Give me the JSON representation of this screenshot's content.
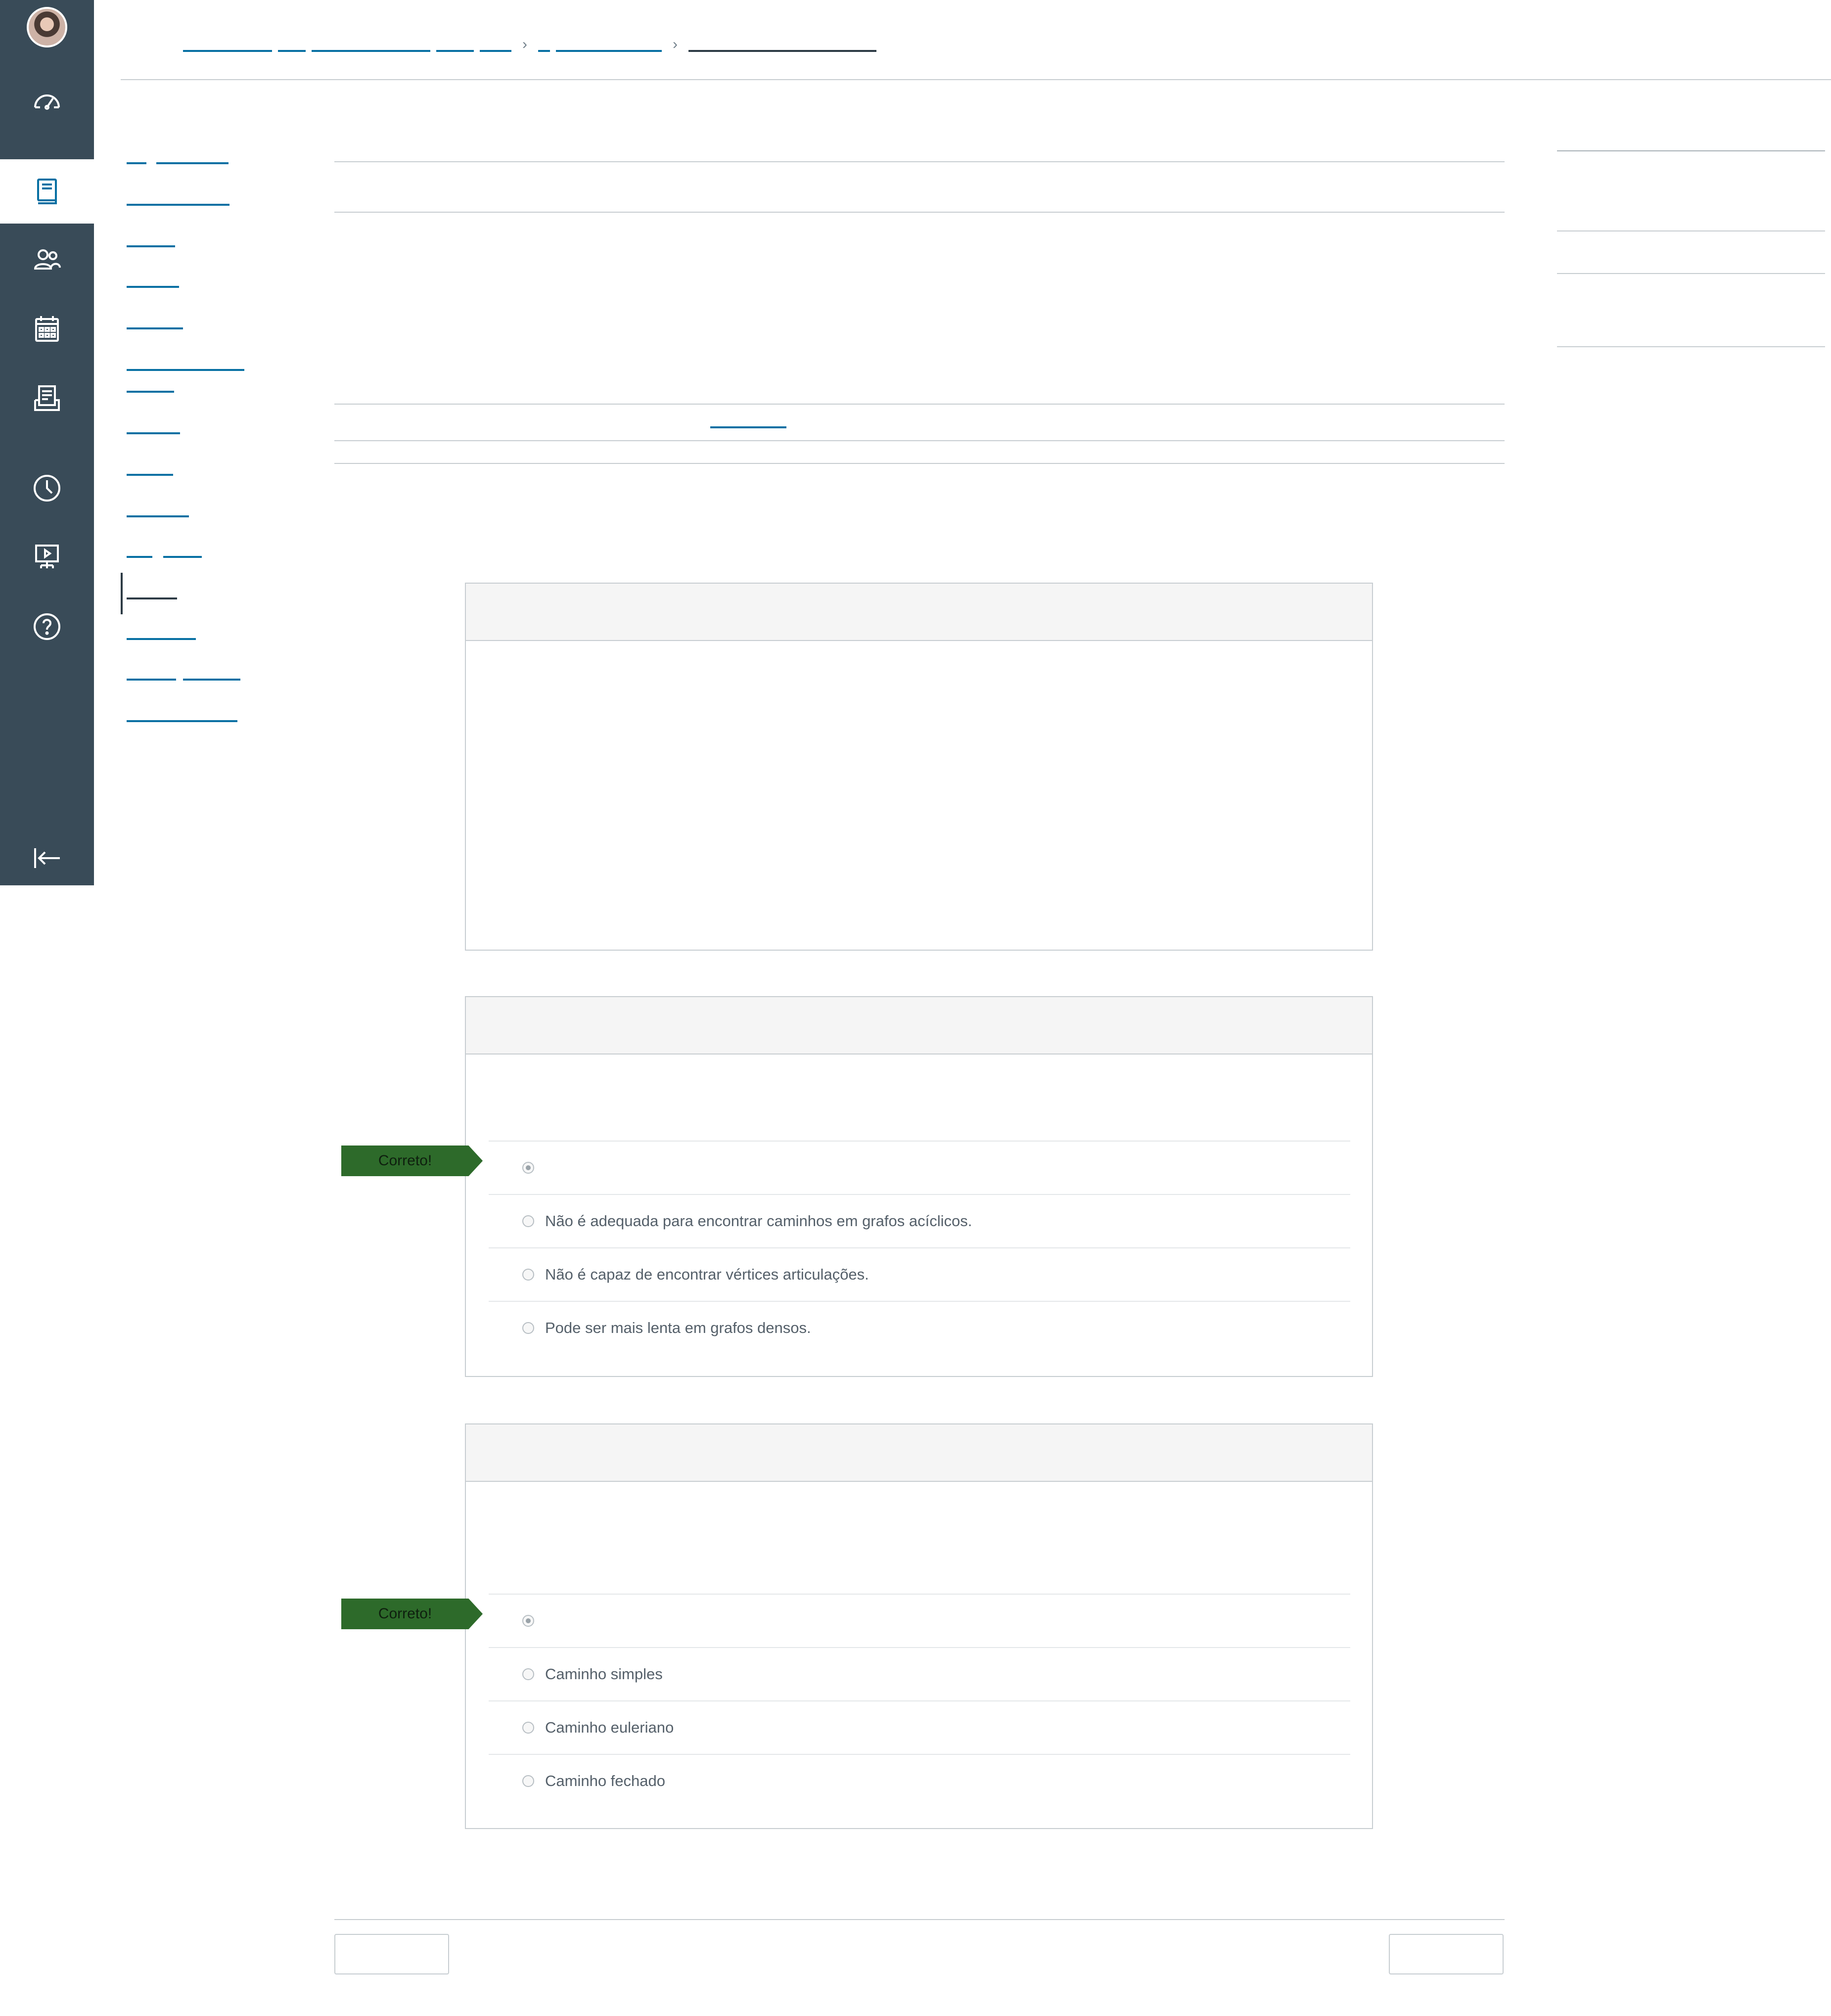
{
  "global_nav": {
    "items": [
      {
        "name": "account-avatar"
      },
      {
        "name": "dashboard-icon"
      },
      {
        "name": "courses-icon",
        "active": true
      },
      {
        "name": "groups-icon"
      },
      {
        "name": "calendar-icon"
      },
      {
        "name": "inbox-icon"
      },
      {
        "name": "history-icon"
      },
      {
        "name": "commons-icon"
      },
      {
        "name": "help-icon"
      },
      {
        "name": "collapse-nav-icon"
      }
    ]
  },
  "quiz": {
    "correct_label": "Correto!",
    "questions": [
      {
        "answers": [
          {
            "text": "",
            "selected": true
          },
          {
            "text": "Não é adequada para encontrar caminhos em grafos acíclicos.",
            "selected": false
          },
          {
            "text": "Não é capaz de encontrar vértices articulações.",
            "selected": false
          },
          {
            "text": "Pode ser mais lenta em grafos densos.",
            "selected": false
          }
        ]
      },
      {
        "answers": [
          {
            "text": "",
            "selected": true
          },
          {
            "text": "Caminho simples",
            "selected": false
          },
          {
            "text": "Caminho euleriano",
            "selected": false
          },
          {
            "text": "Caminho fechado",
            "selected": false
          }
        ]
      }
    ]
  }
}
